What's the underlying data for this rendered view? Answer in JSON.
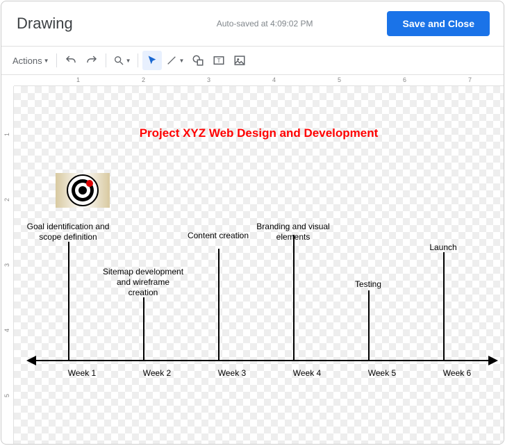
{
  "header": {
    "title": "Drawing",
    "autosave": "Auto-saved at 4:09:02 PM",
    "save_label": "Save and Close"
  },
  "toolbar": {
    "actions_label": "Actions"
  },
  "ruler_h": [
    "1",
    "2",
    "3",
    "4",
    "5",
    "6",
    "7"
  ],
  "ruler_v": [
    "1",
    "2",
    "3",
    "4",
    "5"
  ],
  "chart_data": {
    "type": "timeline",
    "title": "Project XYZ Web Design and Development",
    "axis_labels": [
      "Week 1",
      "Week 2",
      "Week 3",
      "Week 4",
      "Week 5",
      "Week 6"
    ],
    "milestones": [
      {
        "week": 1,
        "label": "Goal identification and scope definition"
      },
      {
        "week": 2,
        "label": "Sitemap development and wireframe creation"
      },
      {
        "week": 3,
        "label": "Content creation"
      },
      {
        "week": 4,
        "label": "Branding and visual elements"
      },
      {
        "week": 5,
        "label": "Testing"
      },
      {
        "week": 6,
        "label": "Launch"
      }
    ]
  }
}
